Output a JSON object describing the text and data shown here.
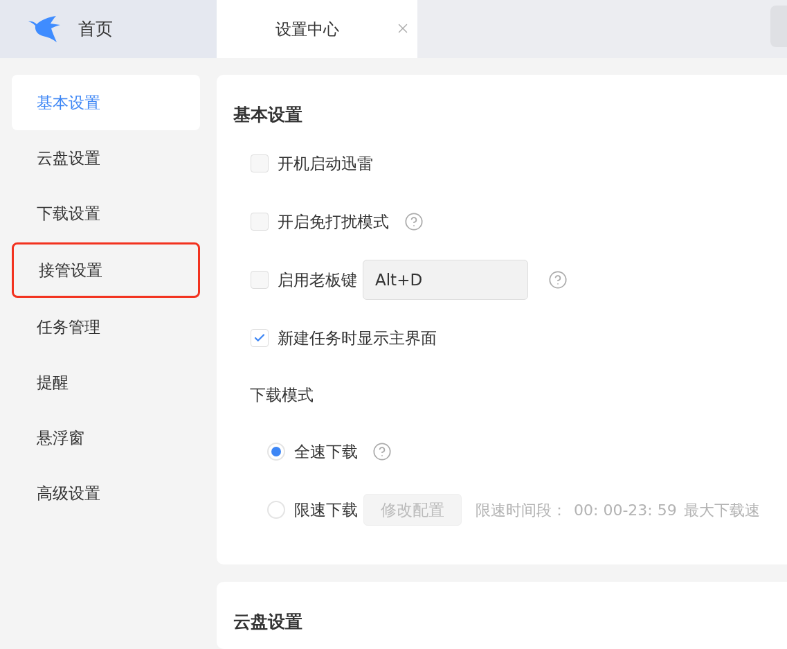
{
  "header": {
    "home": {
      "label": "首页"
    },
    "tabs": [
      {
        "label": "设置中心",
        "selected": true,
        "closable": true
      }
    ]
  },
  "sidebar": {
    "items": [
      {
        "label": "基本设置",
        "selected": true,
        "annotated": false
      },
      {
        "label": "云盘设置",
        "selected": false,
        "annotated": false
      },
      {
        "label": "下载设置",
        "selected": false,
        "annotated": false
      },
      {
        "label": "接管设置",
        "selected": false,
        "annotated": true
      },
      {
        "label": "任务管理",
        "selected": false,
        "annotated": false
      },
      {
        "label": "提醒",
        "selected": false,
        "annotated": false
      },
      {
        "label": "悬浮窗",
        "selected": false,
        "annotated": false
      },
      {
        "label": "高级设置",
        "selected": false,
        "annotated": false
      }
    ]
  },
  "sections": [
    {
      "title": "基本设置",
      "rows": [
        {
          "label": "开机启动迅雷",
          "checked": false,
          "help": false
        },
        {
          "label": "开启免打扰模式",
          "checked": false,
          "help": true
        },
        {
          "label": "启用老板键",
          "checked": false,
          "hotkey": "Alt+D",
          "help": true
        },
        {
          "label": "新建任务时显示主界面",
          "checked": true,
          "help": false
        }
      ],
      "download_mode": {
        "label": "下载模式",
        "options": [
          {
            "label": "全速下载",
            "selected": true,
            "help": true
          },
          {
            "label": "限速下载",
            "selected": false,
            "help": false,
            "button": {
              "label": "修改配置",
              "disabled": true
            },
            "notes": [
              "限速时间段：",
              "00: 00-23: 59",
              "最大下载速"
            ]
          }
        ]
      }
    },
    {
      "title": "云盘设置"
    }
  ]
}
